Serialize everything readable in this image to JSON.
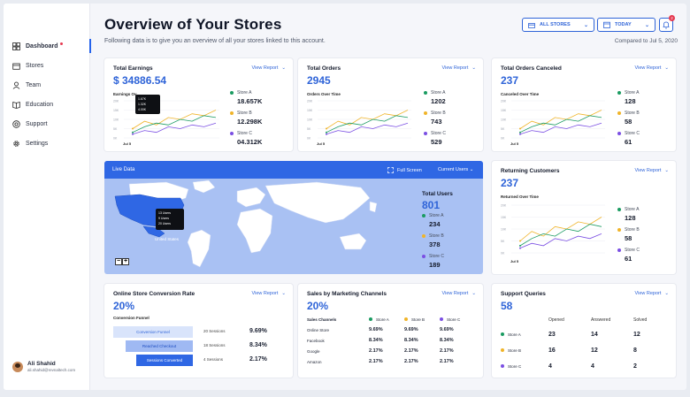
{
  "sidebar": {
    "items": [
      {
        "label": "Dashboard",
        "icon": "dashboard-icon"
      },
      {
        "label": "Stores",
        "icon": "store-icon"
      },
      {
        "label": "Team",
        "icon": "team-icon"
      },
      {
        "label": "Education",
        "icon": "book-icon"
      },
      {
        "label": "Support",
        "icon": "support-icon"
      },
      {
        "label": "Settings",
        "icon": "gear-icon"
      }
    ],
    "user": {
      "name": "Ali Shahid",
      "email": "ali.shahid@revnaltech.com"
    }
  },
  "header": {
    "title": "Overview of Your Stores",
    "subtitle": "Following data is to give you an overview of all your stores linked to this account.",
    "all_stores": "ALL STORES",
    "today": "TODAY",
    "notification_count": "2",
    "compared": "Compared to Jul 5, 2020"
  },
  "colors": {
    "accent": "#2f64d8",
    "storeA": "#1a9b61",
    "storeB": "#f0b429",
    "storeC": "#7b4fe3"
  },
  "view_report": "View Report",
  "total_earnings": {
    "title": "Total Earnings",
    "value": "$ 34886.54",
    "chart_label": "Earnings Ov",
    "tooltip": [
      "1.67K",
      "1.32K",
      "4.00K"
    ],
    "date": "Jul 5",
    "stores": [
      {
        "name": "Store A",
        "value": "18.657K"
      },
      {
        "name": "Store B",
        "value": "12.298K"
      },
      {
        "name": "Store C",
        "value": "04.312K"
      }
    ]
  },
  "total_orders": {
    "title": "Total Orders",
    "value": "2945",
    "chart_label": "Orders Over Time",
    "date": "Jul 5",
    "stores": [
      {
        "name": "Store A",
        "value": "1202"
      },
      {
        "name": "Store B",
        "value": "743"
      },
      {
        "name": "Store C",
        "value": "529"
      }
    ]
  },
  "orders_canceled": {
    "title": "Total Orders Canceled",
    "value": "237",
    "chart_label": "Canceled Over Time",
    "date": "Jul 5",
    "stores": [
      {
        "name": "Store A",
        "value": "128"
      },
      {
        "name": "Store B",
        "value": "58"
      },
      {
        "name": "Store C",
        "value": "61"
      }
    ]
  },
  "returning": {
    "title": "Returning Customers",
    "value": "237",
    "chart_label": "Returned Over Time",
    "date": "Jul 5",
    "stores": [
      {
        "name": "Store A",
        "value": "128"
      },
      {
        "name": "Store B",
        "value": "58"
      },
      {
        "name": "Store C",
        "value": "61"
      }
    ]
  },
  "live": {
    "title": "Live Data",
    "full_screen": "Full Screen",
    "current_users": "Current Users",
    "tooltip": [
      "13 Users",
      "9 Users",
      "20 Users"
    ],
    "country": "United States",
    "total_users_title": "Total Users",
    "total_users": "801",
    "stores": [
      {
        "name": "Store A",
        "value": "234"
      },
      {
        "name": "Store B",
        "value": "378"
      },
      {
        "name": "Store C",
        "value": "189"
      }
    ]
  },
  "conversion": {
    "title": "Online Store Conversion Rate",
    "value": "20%",
    "funnel_label": "Conversion Funnel",
    "rows": [
      {
        "stage": "Conversion Funnel",
        "sessions": "20 Sessions",
        "rate": "9.69%"
      },
      {
        "stage": "Reached Checkout",
        "sessions": "18 Sessions",
        "rate": "8.34%"
      },
      {
        "stage": "Sessions Converted",
        "sessions": "4 Sessions",
        "rate": "2.17%"
      }
    ]
  },
  "marketing": {
    "title": "Sales by Marketing Channels",
    "value": "20%",
    "col_header": "Sales Channels",
    "stores": [
      "Store A",
      "Store B",
      "Store C"
    ],
    "rows": [
      {
        "channel": "Online Store",
        "values": [
          "9.69%",
          "9.69%",
          "9.69%"
        ]
      },
      {
        "channel": "Facebook",
        "values": [
          "8.34%",
          "8.34%",
          "8.34%"
        ]
      },
      {
        "channel": "Google",
        "values": [
          "2.17%",
          "2.17%",
          "2.17%"
        ]
      },
      {
        "channel": "Amazon",
        "values": [
          "2.17%",
          "2.17%",
          "2.17%"
        ]
      }
    ]
  },
  "support": {
    "title": "Support Queries",
    "value": "58",
    "headers": [
      "Opened",
      "Answered",
      "Solved"
    ],
    "rows": [
      {
        "store": "Store A",
        "values": [
          "23",
          "14",
          "12"
        ]
      },
      {
        "store": "Store B",
        "values": [
          "16",
          "12",
          "8"
        ]
      },
      {
        "store": "Store C",
        "values": [
          "4",
          "4",
          "2"
        ]
      }
    ]
  },
  "mini_chart": {
    "y_ticks": [
      "20K",
      "15K",
      "10K",
      "5K",
      "0K"
    ],
    "series": [
      {
        "color": "#f0b429",
        "values": [
          5,
          9,
          7,
          11,
          10,
          13,
          12,
          15
        ]
      },
      {
        "color": "#1a9b61",
        "values": [
          3,
          6,
          8,
          7,
          10,
          9,
          12,
          11
        ]
      },
      {
        "color": "#7b4fe3",
        "values": [
          2,
          4,
          3,
          6,
          5,
          7,
          6,
          8
        ]
      }
    ]
  }
}
